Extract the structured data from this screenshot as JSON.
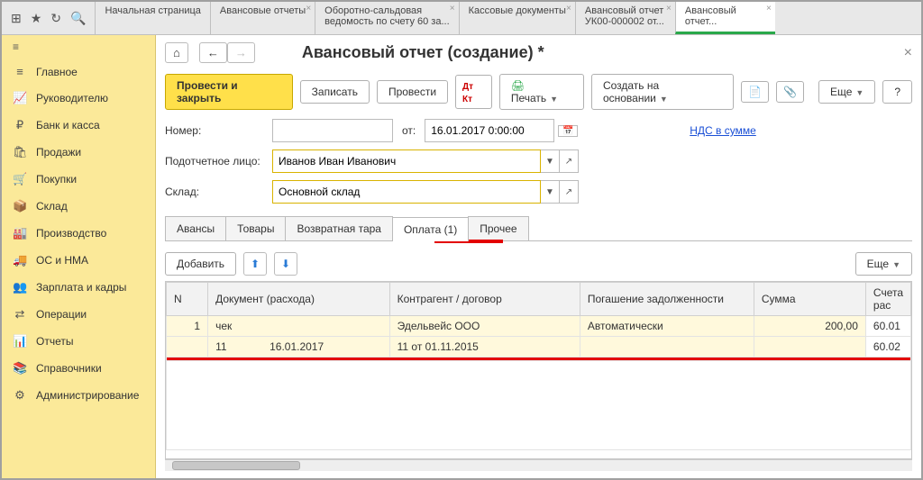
{
  "top_tools": {
    "apps": "⊞",
    "star": "★",
    "history": "↻",
    "search": "🔍"
  },
  "tabs": [
    {
      "label": "Начальная страница"
    },
    {
      "label": "Авансовые отчеты"
    },
    {
      "label": "Оборотно-сальдовая",
      "sub": "ведомость по счету 60 за..."
    },
    {
      "label": "Кассовые документы"
    },
    {
      "label": "Авансовый отчет",
      "sub": "УК00-000002 от..."
    },
    {
      "label": "Авансовый",
      "sub": "отчет..."
    }
  ],
  "sidebar": [
    {
      "icon": "≡",
      "label": "Главное"
    },
    {
      "icon": "📈",
      "label": "Руководителю"
    },
    {
      "icon": "₽",
      "label": "Банк и касса"
    },
    {
      "icon": "🛍",
      "label": "Продажи"
    },
    {
      "icon": "🛒",
      "label": "Покупки"
    },
    {
      "icon": "📦",
      "label": "Склад"
    },
    {
      "icon": "🏭",
      "label": "Производство"
    },
    {
      "icon": "🚚",
      "label": "ОС и НМА"
    },
    {
      "icon": "👥",
      "label": "Зарплата и кадры"
    },
    {
      "icon": "⇄",
      "label": "Операции"
    },
    {
      "icon": "📊",
      "label": "Отчеты"
    },
    {
      "icon": "📚",
      "label": "Справочники"
    },
    {
      "icon": "⚙",
      "label": "Администрирование"
    }
  ],
  "page_title": "Авансовый отчет (создание) *",
  "nav": {
    "home": "⌂",
    "back": "←",
    "fwd": "→",
    "close": "×"
  },
  "toolbar": {
    "post_close": "Провести и закрыть",
    "save": "Записать",
    "post": "Провести",
    "dk": "Дт Кт",
    "print": "Печать",
    "create_from": "Создать на основании",
    "attach_icon": "📄",
    "clip_icon": "📎",
    "more": "Еще",
    "help": "?"
  },
  "form": {
    "number_label": "Номер:",
    "number_value": "",
    "from_label": "от:",
    "date_value": "16.01.2017 0:00:00",
    "vat_link": "НДС в сумме",
    "person_label": "Подотчетное лицо:",
    "person_value": "Иванов Иван Иванович",
    "warehouse_label": "Склад:",
    "warehouse_value": "Основной склад"
  },
  "doc_tabs": [
    "Авансы",
    "Товары",
    "Возвратная тара",
    "Оплата (1)",
    "Прочее"
  ],
  "grid_toolbar": {
    "add": "Добавить",
    "up": "⬆",
    "down": "⬇",
    "more": "Еще"
  },
  "grid": {
    "headers": [
      "N",
      "Документ (расхода)",
      "Контрагент / договор",
      "Погашение задолженности",
      "Сумма",
      "Счета рас"
    ],
    "row1": {
      "n": "1",
      "doc": "чек",
      "cp": "Эдельвейс ООО",
      "pay": "Автоматически",
      "sum": "200,00",
      "acc": "60.01"
    },
    "row2": {
      "n": "",
      "doc_no": "11",
      "doc_date": "16.01.2017",
      "cp": "11 от 01.11.2015",
      "pay": "",
      "sum": "",
      "acc": "60.02"
    }
  }
}
